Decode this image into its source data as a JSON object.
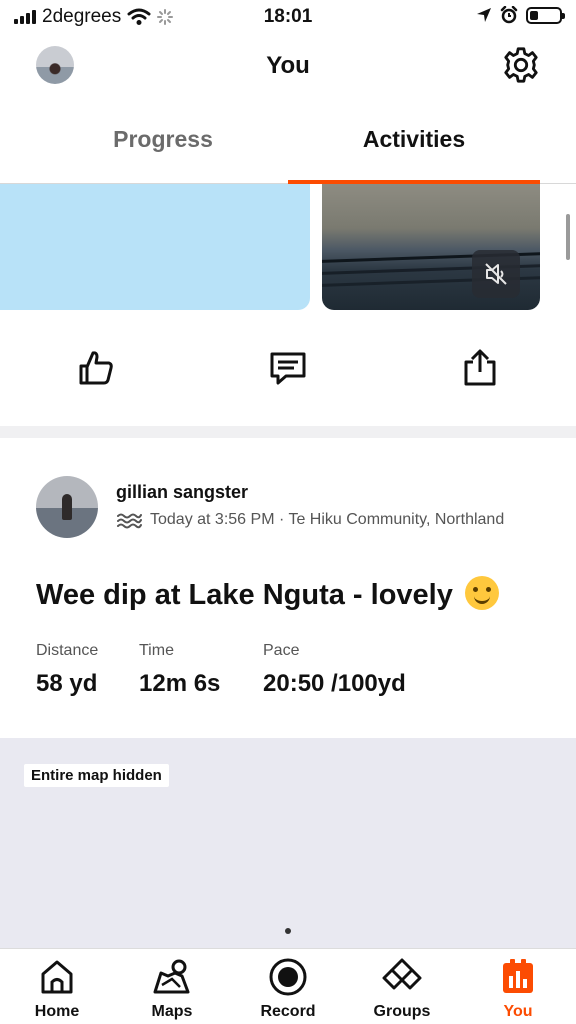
{
  "status_bar": {
    "carrier": "2degrees",
    "time": "18:01"
  },
  "header": {
    "title": "You",
    "avatar_icon": "avatar",
    "settings_icon": "gear-icon"
  },
  "tabs": [
    {
      "label": "Progress",
      "active": false
    },
    {
      "label": "Activities",
      "active": true
    }
  ],
  "colors": {
    "accent": "#fc4c02",
    "media_placeholder": "#b8e2f8",
    "map_bg": "#e9e9f1"
  },
  "media": {
    "mute_icon": "speaker-muted-icon"
  },
  "actions": {
    "icons": [
      "thumbs-up-icon",
      "comment-icon",
      "share-icon"
    ]
  },
  "activity": {
    "athlete_name": "gillian sangster",
    "sport_icon": "swim-icon",
    "meta": "Today at 3:56 PM · Te Hiku Community, Northland",
    "title": "Wee dip at Lake Nguta - lovely",
    "stats": [
      {
        "label": "Distance",
        "value": "58 yd"
      },
      {
        "label": "Time",
        "value": "12m 6s"
      },
      {
        "label": "Pace",
        "value": "20:50 /100yd"
      }
    ]
  },
  "map": {
    "badge": "Entire map hidden"
  },
  "bottom_nav": [
    {
      "label": "Home",
      "icon": "home-icon"
    },
    {
      "label": "Maps",
      "icon": "maps-icon"
    },
    {
      "label": "Record",
      "icon": "record-icon"
    },
    {
      "label": "Groups",
      "icon": "groups-icon"
    },
    {
      "label": "You",
      "icon": "you-icon",
      "active": true
    }
  ]
}
